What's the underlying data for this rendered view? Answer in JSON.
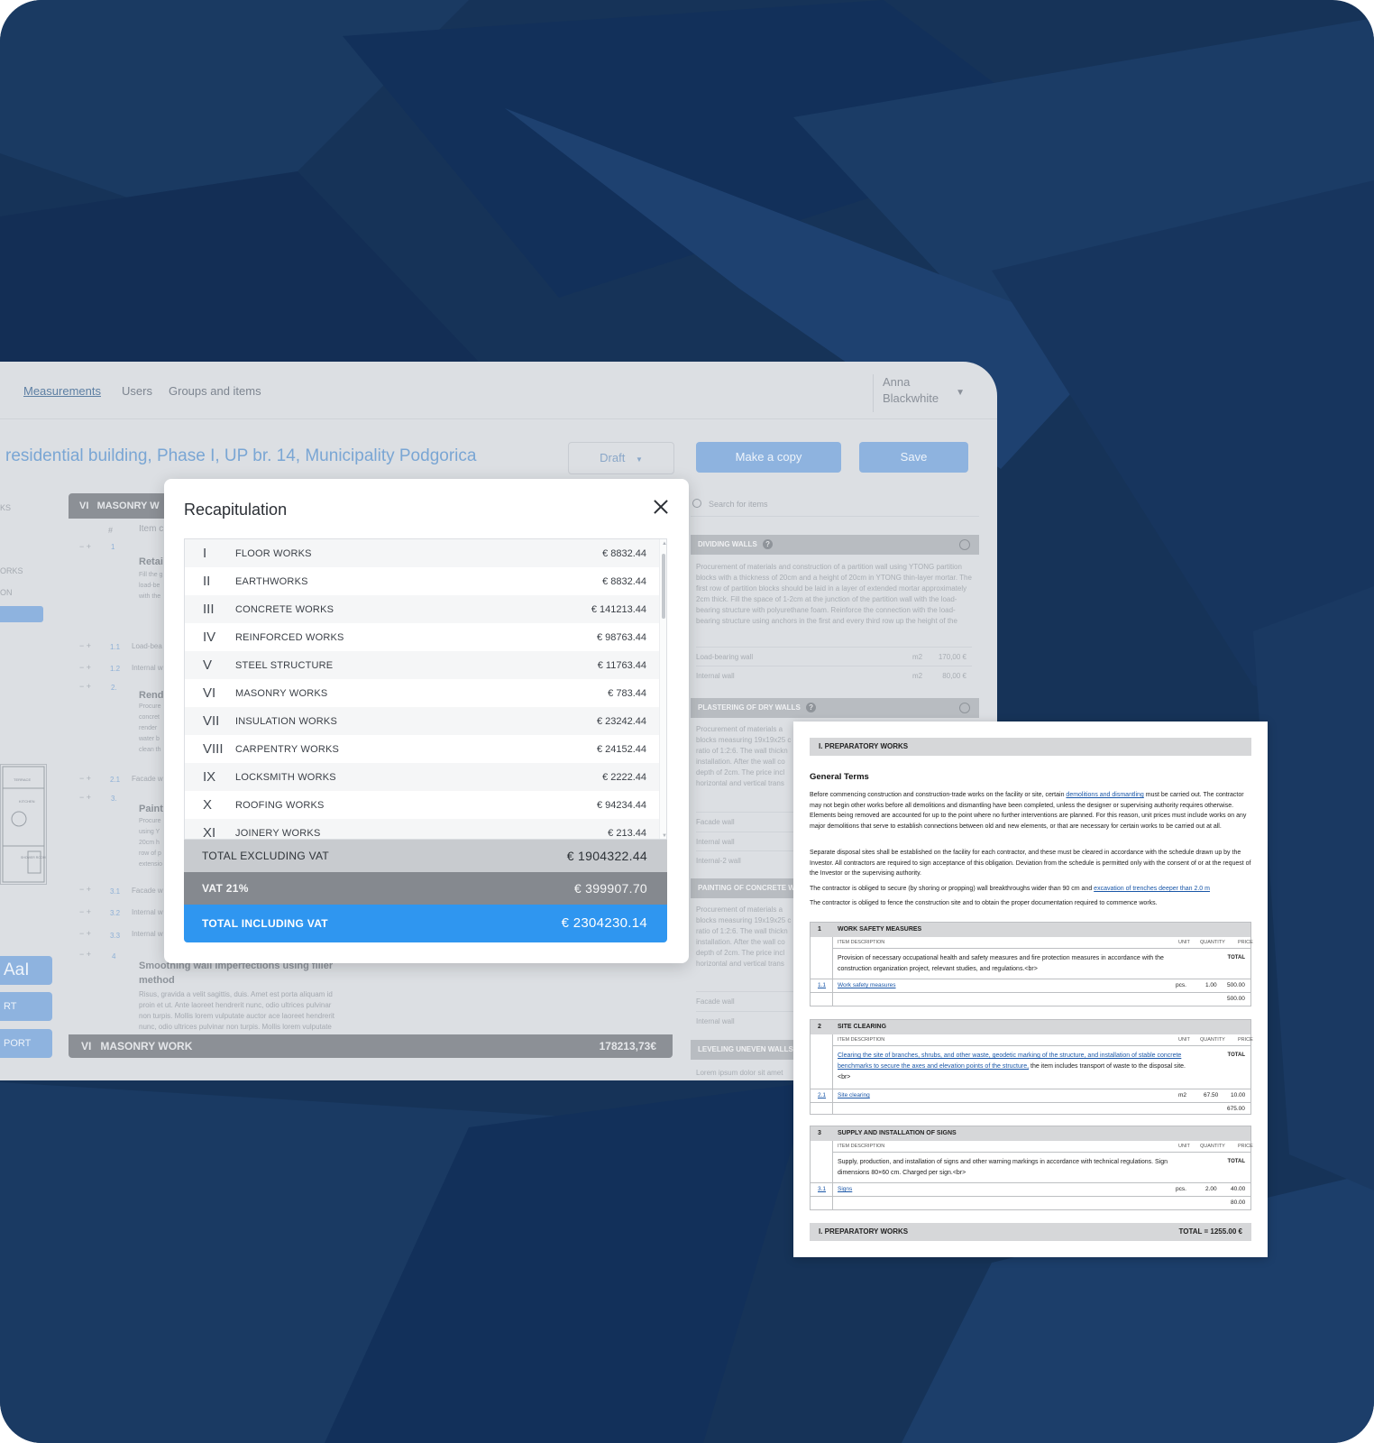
{
  "nav": {
    "links": [
      "Measurements",
      "Users",
      "Groups and items"
    ],
    "user_first": "Anna",
    "user_last": "Blackwhite"
  },
  "header": {
    "title": "residential building, Phase I, UP br. 14, Municipality Podgorica",
    "status": "Draft",
    "copy_label": "Make a copy",
    "save_label": "Save"
  },
  "left": {
    "section_number": "VI",
    "section_name": "MASONRY W",
    "col_hash": "#",
    "col_item": "Item c",
    "footer_number": "VI",
    "footer_name": "MASONRY WORK",
    "footer_total": "178213,73€",
    "rows": {
      "r1_num": "1",
      "r1_title": "Retai",
      "r1_l1": "Fill the g",
      "r1_l2": "load-be",
      "r1_l3": "with the",
      "r11_num": "1.1",
      "r11_text": "Load-bea",
      "r12_num": "1.2",
      "r12_text": "Internal w",
      "r2_num": "2.",
      "r2_title": "Rend",
      "r2_l1": "Procure",
      "r2_l2": "concret",
      "r2_l3": "render",
      "r2_l4": "water b",
      "r2_l5": "clean th",
      "r21_num": "2.1",
      "r21_text": "Facade w",
      "r3_num": "3.",
      "r3_title": "Paint",
      "r3_l1": "Procure",
      "r3_l2": "using Y",
      "r3_l3": "20cm h",
      "r3_l4": "row of p",
      "r3_l5": "extensio",
      "r31_num": "3.1",
      "r31_text": "Facade w",
      "r32_num": "3.2",
      "r32_text": "Internal w",
      "r33_num": "3.3",
      "r33_text": "Internal w",
      "r4_num": "4",
      "r4_title": "Smoothing wall imperfections using filler",
      "r4_title2": "method",
      "r4_l1": " Risus, gravida a velit sagittis, duis. Amet est porta aliquam id",
      "r4_l2": "proin et ut. Ante laoreet hendrerit nunc, odio ultrices pulvinar",
      "r4_l3": "non turpis. Mollis lorem vulputate auctor ace laoreet hendrerit",
      "r4_l4": "nunc, odio ultrices pulvinar non turpis. Mollis lorem vulputate"
    },
    "sidebar_items": [
      "KS",
      "ORKS",
      "ON"
    ],
    "side_buttons": [
      "AaI",
      "RT",
      "PORT"
    ],
    "plan_labels": [
      "TERRACE",
      "KITCHEN",
      "SHOWER ROOM"
    ]
  },
  "right_panel": {
    "search_placeholder": "Search for items",
    "g1_title": "DIVIDING WALLS",
    "g1_text": "Procurement of materials and construction of a partition wall using YTONG partition blocks with a thickness of 20cm and a height of 20cm in YTONG thin-layer mortar. The first row of partition blocks should be laid in a layer of extended mortar approximately 2cm thick. Fill the space of 1-2cm at the junction of the partition wall with the load-bearing structure with polyurethane foam. Reinforce the connection with the load-bearing structure using anchors in the first and every third row up the height of the",
    "g1_rows": [
      {
        "name": "Load-bearing wall",
        "unit": "m2",
        "price": "170,00 €"
      },
      {
        "name": "Internal wall",
        "unit": "m2",
        "price": "80,00 €"
      }
    ],
    "g2_title": "PLASTERING OF DRY WALLS",
    "g2_text": "Procurement of materials a blocks measuring 19x19x25 c ratio of 1:2:6. The wall thickn installation. After the wall co depth of 2cm. The price incl horizontal and vertical trans",
    "g2_rows": [
      "Facade wall",
      "Internal wall",
      "Internal-2 wall"
    ],
    "g3_title": "PAINTING OF CONCRETE W",
    "g3_text": "Procurement of materials a blocks measuring 19x19x25 c ratio of 1:2:6. The wall thickn installation. After the wall co depth of 2cm. The price incl horizontal and vertical trans",
    "g3_rows": [
      "Facade wall",
      "Internal wall"
    ],
    "g4_title": "LEVELING UNEVEN WALLS U",
    "g4_text": "Lorem ipsum dolor sit amet"
  },
  "modal": {
    "title": "Recapitulation",
    "rows": [
      {
        "roman": "I",
        "name": "FLOOR WORKS",
        "value": "€ 8832.44"
      },
      {
        "roman": "II",
        "name": "EARTHWORKS",
        "value": "€ 8832.44"
      },
      {
        "roman": "III",
        "name": "CONCRETE WORKS",
        "value": "€ 141213.44"
      },
      {
        "roman": "IV",
        "name": "REINFORCED WORKS",
        "value": "€ 98763.44"
      },
      {
        "roman": "V",
        "name": "STEEL STRUCTURE",
        "value": "€ 11763.44"
      },
      {
        "roman": "VI",
        "name": "MASONRY WORKS",
        "value": "€ 783.44"
      },
      {
        "roman": "VII",
        "name": "INSULATION WORKS",
        "value": "€ 23242.44"
      },
      {
        "roman": "VIII",
        "name": "CARPENTRY WORKS",
        "value": "€ 24152.44"
      },
      {
        "roman": "IX",
        "name": "LOCKSMITH WORKS",
        "value": "€ 2222.44"
      },
      {
        "roman": "X",
        "name": "ROOFING WORKS",
        "value": "€ 94234.44"
      },
      {
        "roman": "XI",
        "name": "JOINERY WORKS",
        "value": "€ 213.44"
      }
    ],
    "total_excl_label": "TOTAL EXCLUDING VAT",
    "total_excl_value": "€ 1904322.44",
    "vat_label": "VAT 21%",
    "vat_value": "€ 399907.70",
    "total_incl_label": "TOTAL INCLUDING VAT",
    "total_incl_value": "€ 2304230.14"
  },
  "document": {
    "header": "I. PREPARATORY WORKS",
    "general_terms": "General Terms",
    "p1a": "Before commencing construction and construction-trade works on the facility or site, certain ",
    "p1_link": "demolitions and dismantling",
    "p1b": " must be carried out. The contractor may not begin other works before all demolitions and dismantling have been completed, unless the designer or supervising authority requires otherwise. Elements being removed are accounted for up to the point where no further interventions are planned. For this reason, unit prices must include works on any major demolitions that serve to establish connections between old and new elements, or that are necessary for certain works to be carried out at all.",
    "p2": "Separate disposal sites shall be established on the facility for each contractor, and these must be cleared in accordance with the schedule drawn up by the Investor. All contractors are required to sign acceptance of this obligation. Deviation from the schedule is permitted only with the consent of or at the request of the Investor or the supervising authority.",
    "p3a": "The contractor is obliged to secure (by shoring or propping) wall breakthroughs wider than 90 cm and ",
    "p3_link": "excavation of trenches deeper than 2.0 m",
    "p4": "The contractor is obliged to fence the construction site and to obtain the proper documentation required to commence works.",
    "col_desc": "ITEM DESCRIPTION",
    "col_unit": "UNIT",
    "col_qty": "QUANTITY",
    "col_price": "PRICE",
    "total_word": "TOTAL",
    "t1": {
      "num": "1",
      "title": "WORK SAFETY MEASURES",
      "desc": "Provision of necessary occupational health and safety measures and fire protection measures in accordance with the construction organization project, relevant studies, and regulations.<br>",
      "item_num": "1.1",
      "item_name": "Work safety measures",
      "unit": "pcs.",
      "qty": "1.00",
      "price": "500.00",
      "total": "500.00"
    },
    "t2": {
      "num": "2",
      "title": "SITE CLEARING",
      "desc_link": "Clearing the site of branches, shrubs, and other waste, geodetic marking of the structure, and installation of stable concrete benchmarks to secure the axes and elevation points of the structure,",
      "desc_rest": " the item includes transport of waste to the disposal site. <br>",
      "item_num": "2.1",
      "item_name": "Site clearing",
      "unit": "m2",
      "qty": "67.50",
      "price": "10.00",
      "total": "675.00"
    },
    "t3": {
      "num": "3",
      "title": "SUPPLY AND INSTALLATION OF SIGNS",
      "desc": "Supply, production, and installation of signs and other warning markings in accordance with technical regulations. Sign dimensions 80×60 cm. Charged per sign.<br>",
      "item_num": "3.1",
      "item_name": "Signs",
      "unit": "pcs.",
      "qty": "2.00",
      "price": "40.00",
      "total": "80.00"
    },
    "footer_label": "I. PREPARATORY WORKS",
    "footer_total": "TOTAL = 1255.00 €"
  }
}
